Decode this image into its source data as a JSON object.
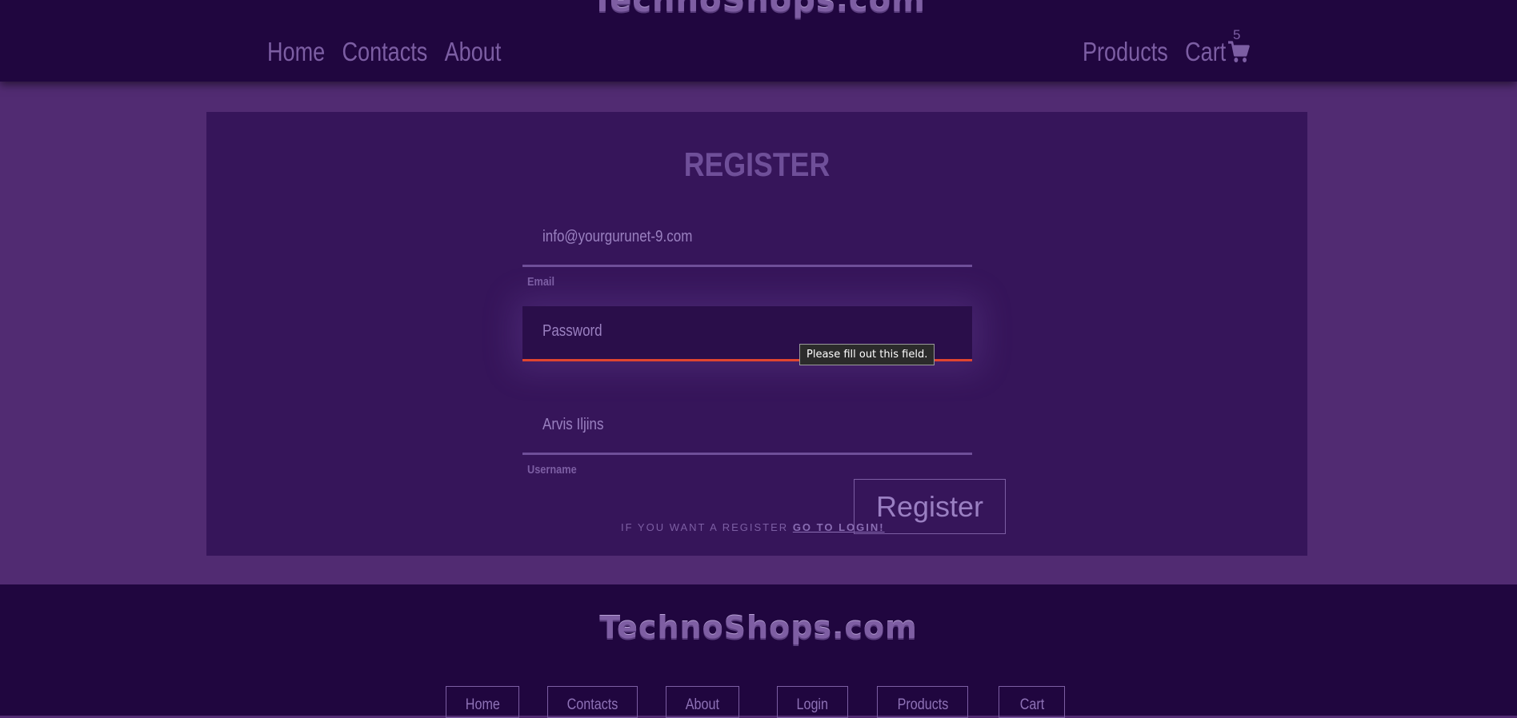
{
  "brand": {
    "logo_text": "TechnoShops.com"
  },
  "nav": {
    "left": [
      {
        "label": "Home"
      },
      {
        "label": "Contacts"
      },
      {
        "label": "About"
      }
    ],
    "right": [
      {
        "label": "Products"
      },
      {
        "label": "Cart"
      }
    ],
    "cart_count": "5",
    "cart_icon": "shopping-cart-icon"
  },
  "form": {
    "title": "REGISTER",
    "email": {
      "value": "info@yourgurunet-9.com",
      "label": "Email"
    },
    "password": {
      "placeholder": "Password",
      "tooltip": "Please fill out this field."
    },
    "username": {
      "value": "Arvis Iljins",
      "label": "Username"
    },
    "login_prompt": "IF YOU WANT A REGISTER",
    "login_link": "GO TO LOGIN!",
    "submit_label": "Register"
  },
  "footer": {
    "logo_text": "TechnoShops.com",
    "links": [
      {
        "label": "Home"
      },
      {
        "label": "Contacts"
      },
      {
        "label": "About"
      },
      {
        "label": "Login"
      },
      {
        "label": "Products"
      },
      {
        "label": "Cart"
      }
    ]
  },
  "colors": {
    "header_bg": "#20063f",
    "page_bg": "#512b72",
    "panel_bg": "#36155a",
    "accent": "#7c5ea3",
    "error": "#e0452f"
  }
}
